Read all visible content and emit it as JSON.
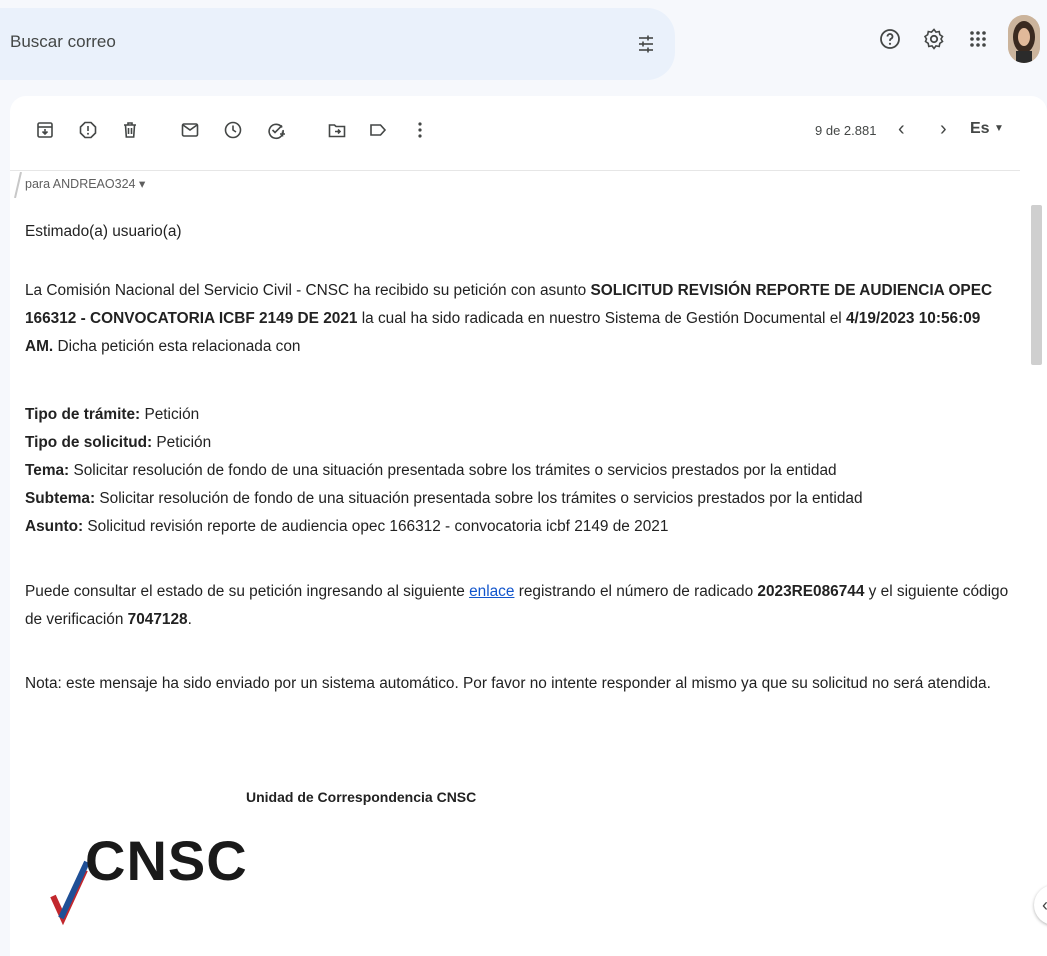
{
  "search": {
    "placeholder": "Buscar correo"
  },
  "header_icons": [
    "tune-icon",
    "help-icon",
    "settings-icon",
    "apps-icon",
    "avatar"
  ],
  "toolbar": {
    "icons": [
      "archive-icon",
      "report-spam-icon",
      "delete-icon",
      "mark-unread-icon",
      "snooze-icon",
      "add-task-icon",
      "move-to-icon",
      "label-icon",
      "more-icon"
    ],
    "page_count": "9 de 2.881",
    "language": "Es"
  },
  "message": {
    "recipient": "para ANDREAO324 ▾",
    "greeting": "Estimado(a) usuario(a)",
    "intro_part1": "La Comisión Nacional del Servicio Civil - CNSC ha recibido su petición con asunto ",
    "intro_subject_bold": "SOLICITUD REVISIÓN REPORTE DE AUDIENCIA OPEC 166312 - CONVOCATORIA ICBF 2149 DE 2021",
    "intro_part2": " la cual ha sido radicada en nuestro Sistema de Gestión Documental el ",
    "intro_date_bold": "4/19/2023 10:56:09 AM.",
    "intro_part3": " Dicha petición esta relacionada con",
    "details": [
      {
        "label": "Tipo de trámite:",
        "value": " Petición"
      },
      {
        "label": "Tipo de solicitud:",
        "value": " Petición"
      },
      {
        "label": "Tema:",
        "value": " Solicitar resolución de fondo de una situación presentada sobre los trámites o servicios prestados por la entidad"
      },
      {
        "label": "Subtema:",
        "value": " Solicitar resolución de fondo de una situación presentada sobre los trámites o servicios prestados por la entidad"
      },
      {
        "label": "Asunto:",
        "value": " Solicitud revisión reporte de audiencia opec 166312 - convocatoria icbf 2149 de 2021"
      }
    ],
    "consult_part1": "Puede consultar el estado de su petición ingresando al siguiente ",
    "consult_link": "enlace",
    "consult_part2": " registrando el número de radicado ",
    "radicado": "2023RE086744",
    "consult_part3": " y el siguiente código de verificación ",
    "codigo": "7047128",
    "consult_part4": ".",
    "note": "Nota: este mensaje ha sido enviado por un sistema automático. Por favor no intente responder al mismo ya que su solicitud no será atendida."
  },
  "signature": {
    "title": "Unidad de Correspondencia CNSC",
    "logo_text": "CNSC"
  },
  "colors": {
    "link": "#1155cc",
    "search_bg": "#eaf1fb",
    "page_bg": "#f6f8fc"
  }
}
